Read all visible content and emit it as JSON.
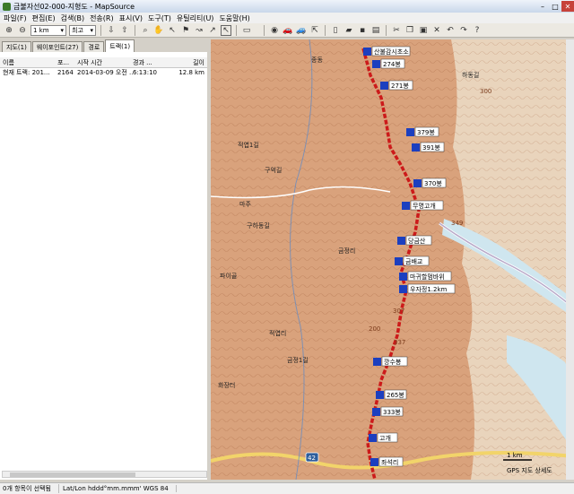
{
  "window": {
    "title": "금불자선02-000-지형도 - MapSource"
  },
  "menu": [
    "파일(F)",
    "편집(E)",
    "검색(B)",
    "전송(R)",
    "표시(V)",
    "도구(T)",
    "유틸리티(U)",
    "도움말(H)"
  ],
  "toolbar": {
    "scale_value": "1 km",
    "detail_value": "최고"
  },
  "tabs": [
    "지도(1)",
    "웨이포인트(27)",
    "경로",
    "트랙(1)"
  ],
  "track_table": {
    "headers": [
      "이름",
      "포...",
      "시작 시간",
      "경과 ...",
      "길이"
    ],
    "rows": [
      [
        "현재 트랙: 201...",
        "2164",
        "2014-03-09 오전 ...",
        "6:13:10",
        "12.8 km"
      ]
    ]
  },
  "map": {
    "colors": {
      "terrain": "#d9a27c",
      "track": "#cc1a1a",
      "river": "#cfe6ef",
      "flat": "#eee4d2"
    },
    "waypoints": [
      "산불감시초소",
      "274봉",
      "271봉",
      "379봉",
      "391봉",
      "370봉",
      "무명고개",
      "당금산",
      "금배교",
      "마귀할멈바위",
      "우자정1.2km",
      "깡수봉",
      "265봉",
      "333봉",
      "고개",
      "좌석리"
    ],
    "place_labels": [
      "적엽1길",
      "구억길",
      "종동",
      "마주",
      "구하동길",
      "금정리",
      "파이골",
      "적엽리",
      "금정1길",
      "화장터",
      "하동길"
    ],
    "elevation_labels": [
      "300",
      "200",
      "349",
      "337",
      "307"
    ],
    "road_badge": "42",
    "scale_bar": "1 km",
    "gps_status": "GPS 지도 상세도"
  },
  "status": {
    "selection": "0개 항목이 선택됨",
    "coord_format": "Lat/Lon hddd°mm.mmm' WGS 84"
  }
}
